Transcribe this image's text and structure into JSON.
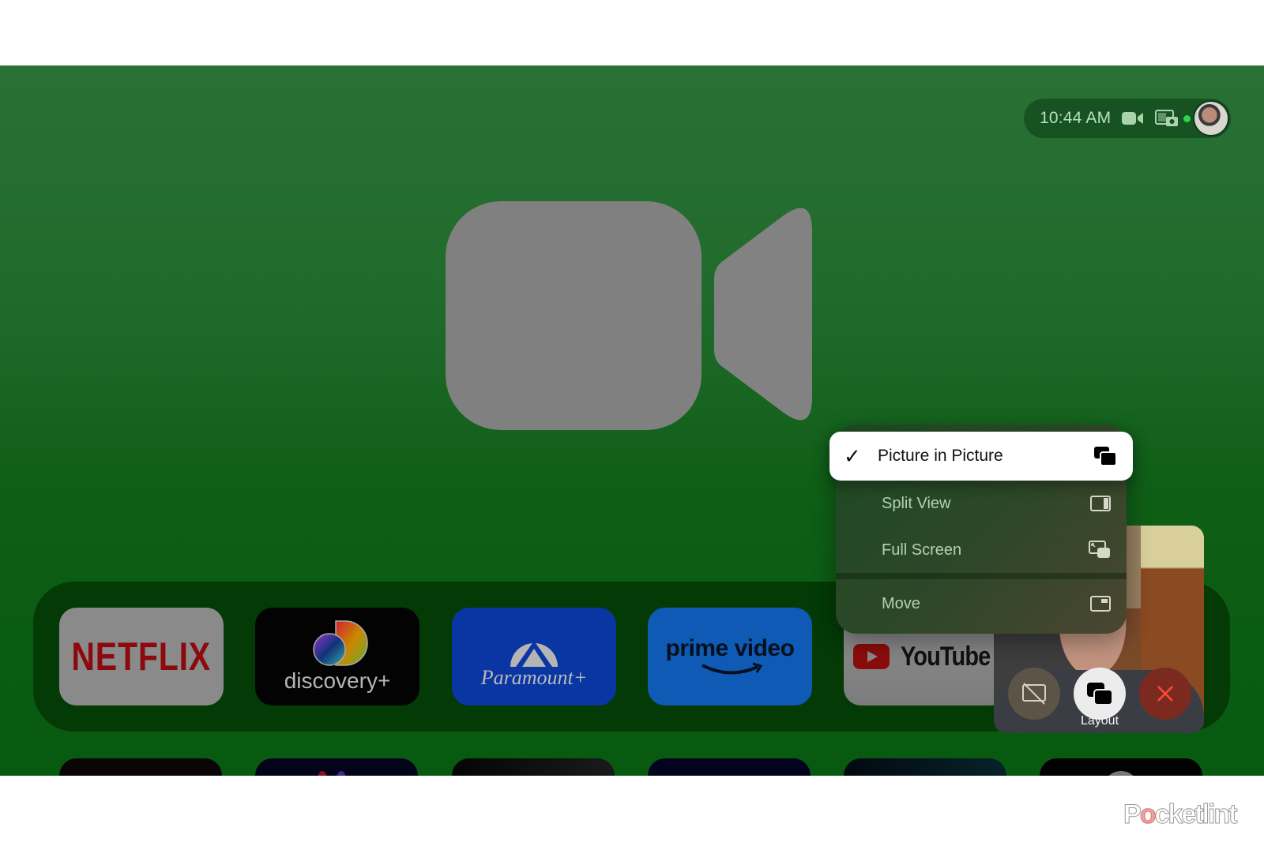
{
  "status_bar": {
    "time": "10:44 AM",
    "icons": [
      "facetime-camera-icon",
      "screen-share-camera-icon",
      "active-indicator-dot",
      "user-avatar"
    ],
    "active_dot_color": "#2fd24a"
  },
  "background": {
    "app_icon": "facetime-camera-icon",
    "accent_color": "#1f6a2b"
  },
  "apps_row1": [
    {
      "name": "Netflix",
      "label": "NETFLIX",
      "color": "#8c0a0d"
    },
    {
      "name": "discovery+",
      "label": "discovery+"
    },
    {
      "name": "Paramount+",
      "label": "Paramount+"
    },
    {
      "name": "prime video",
      "label": "prime video"
    },
    {
      "name": "YouTube",
      "label": "YouTube"
    }
  ],
  "layout_menu": {
    "items": [
      {
        "label": "Picture in Picture",
        "selected": true,
        "check": "✓",
        "icon": "picture-in-picture-icon"
      },
      {
        "label": "Split View",
        "selected": false,
        "icon": "split-view-icon"
      },
      {
        "label": "Full Screen",
        "selected": false,
        "icon": "full-screen-icon"
      },
      {
        "label": "Move",
        "selected": false,
        "icon": "move-icon"
      }
    ]
  },
  "call_controls": {
    "share_screen_off": "screen-share-off-icon",
    "layout_label": "Layout",
    "end_call": "close-icon",
    "end_color": "#e8443a"
  },
  "watermark": {
    "text_pre": "P",
    "text_o": "o",
    "text_post": "cketlint"
  }
}
